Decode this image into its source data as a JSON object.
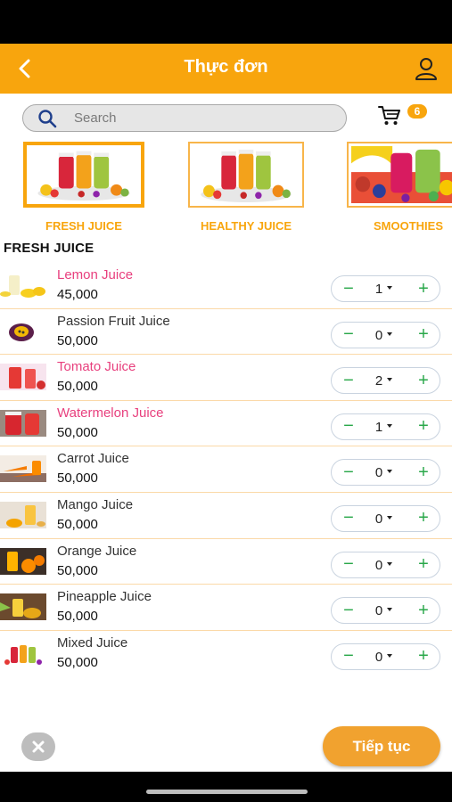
{
  "header": {
    "title": "Thực đơn"
  },
  "search": {
    "placeholder": "Search"
  },
  "cart": {
    "count": "6"
  },
  "categories": [
    {
      "label": "FRESH JUICE",
      "active": true
    },
    {
      "label": "HEALTHY JUICE",
      "active": false
    },
    {
      "label": "SMOOTHIES",
      "active": false
    }
  ],
  "section": {
    "title": "FRESH JUICE"
  },
  "products": [
    {
      "name": "Lemon Juice",
      "price": "45,000",
      "qty": "1"
    },
    {
      "name": "Passion Fruit Juice",
      "price": "50,000",
      "qty": "0"
    },
    {
      "name": "Tomato Juice",
      "price": "50,000",
      "qty": "2"
    },
    {
      "name": "Watermelon Juice",
      "price": "50,000",
      "qty": "1"
    },
    {
      "name": "Carrot Juice",
      "price": "50,000",
      "qty": "0"
    },
    {
      "name": "Mango Juice",
      "price": "50,000",
      "qty": "0"
    },
    {
      "name": "Orange Juice",
      "price": "50,000",
      "qty": "0"
    },
    {
      "name": "Pineapple Juice",
      "price": "50,000",
      "qty": "0"
    },
    {
      "name": "Mixed Juice",
      "price": "50,000",
      "qty": "0"
    }
  ],
  "footer": {
    "continue_label": "Tiếp tục"
  },
  "colors": {
    "accent": "#f8a50d",
    "selected_text": "#e8407e",
    "qty_control": "#2aa84a"
  },
  "icons": {
    "back": "chevron-left-icon",
    "user": "user-icon",
    "search": "search-icon",
    "cart": "cart-icon",
    "clear": "close-icon",
    "qty_minus": "minus-icon",
    "qty_plus": "plus-icon"
  }
}
